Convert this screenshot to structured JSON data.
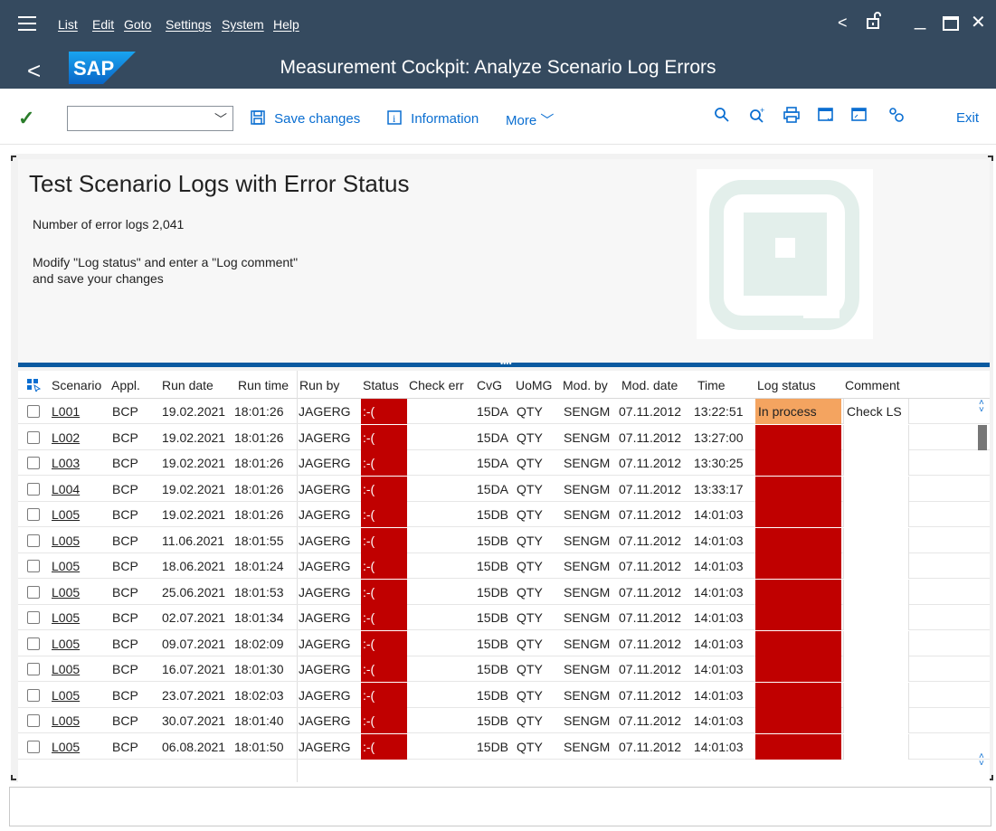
{
  "menu": [
    "List",
    "Edit",
    "Goto",
    "Settings",
    "System",
    "Help"
  ],
  "window_controls": [
    "<",
    "unlock",
    "_",
    "□",
    "×"
  ],
  "app": {
    "logo_text": "SAP",
    "title": "Measurement Cockpit: Analyze Scenario Log Errors"
  },
  "toolbar": {
    "command_value": "",
    "save_label": "Save changes",
    "info_label": "Information",
    "more_label": "More",
    "exit_label": "Exit",
    "icons": [
      "search-icon",
      "search-next-icon",
      "print-icon",
      "layout-icon",
      "window-icon",
      "settings-icon"
    ]
  },
  "header": {
    "title": "Test Scenario Logs with Error Status",
    "count_line": "Number of error logs 2,041",
    "instr1": "Modify \"Log status\" and enter a \"Log comment\"",
    "instr2": "and save your changes"
  },
  "table": {
    "columns": [
      "Scenario",
      "Appl.",
      "Run date",
      "Run time",
      "Run by",
      "Status",
      "Check err",
      "CvG",
      "UoMG",
      "Mod. by",
      "Mod. date",
      "Time",
      "Log status",
      "Comment"
    ],
    "rows": [
      {
        "scenario": "L001",
        "appl": "BCP",
        "run_date": "19.02.2021",
        "run_time": "18:01:26",
        "run_by": "JAGERG",
        "status": ":-(",
        "cvg": "15DA",
        "uomg": "QTY",
        "mod_by": "SENGM",
        "mod_date": "07.11.2012",
        "time": "13:22:51",
        "log_status": "In process",
        "comment": "Check LS"
      },
      {
        "scenario": "L002",
        "appl": "BCP",
        "run_date": "19.02.2021",
        "run_time": "18:01:26",
        "run_by": "JAGERG",
        "status": ":-(",
        "cvg": "15DA",
        "uomg": "QTY",
        "mod_by": "SENGM",
        "mod_date": "07.11.2012",
        "time": "13:27:00",
        "log_status": "",
        "comment": ""
      },
      {
        "scenario": "L003",
        "appl": "BCP",
        "run_date": "19.02.2021",
        "run_time": "18:01:26",
        "run_by": "JAGERG",
        "status": ":-(",
        "cvg": "15DA",
        "uomg": "QTY",
        "mod_by": "SENGM",
        "mod_date": "07.11.2012",
        "time": "13:30:25",
        "log_status": "",
        "comment": ""
      },
      {
        "scenario": "L004",
        "appl": "BCP",
        "run_date": "19.02.2021",
        "run_time": "18:01:26",
        "run_by": "JAGERG",
        "status": ":-(",
        "cvg": "15DA",
        "uomg": "QTY",
        "mod_by": "SENGM",
        "mod_date": "07.11.2012",
        "time": "13:33:17",
        "log_status": "",
        "comment": ""
      },
      {
        "scenario": "L005",
        "appl": "BCP",
        "run_date": "19.02.2021",
        "run_time": "18:01:26",
        "run_by": "JAGERG",
        "status": ":-(",
        "cvg": "15DB",
        "uomg": "QTY",
        "mod_by": "SENGM",
        "mod_date": "07.11.2012",
        "time": "14:01:03",
        "log_status": "",
        "comment": ""
      },
      {
        "scenario": "L005",
        "appl": "BCP",
        "run_date": "11.06.2021",
        "run_time": "18:01:55",
        "run_by": "JAGERG",
        "status": ":-(",
        "cvg": "15DB",
        "uomg": "QTY",
        "mod_by": "SENGM",
        "mod_date": "07.11.2012",
        "time": "14:01:03",
        "log_status": "",
        "comment": ""
      },
      {
        "scenario": "L005",
        "appl": "BCP",
        "run_date": "18.06.2021",
        "run_time": "18:01:24",
        "run_by": "JAGERG",
        "status": ":-(",
        "cvg": "15DB",
        "uomg": "QTY",
        "mod_by": "SENGM",
        "mod_date": "07.11.2012",
        "time": "14:01:03",
        "log_status": "",
        "comment": ""
      },
      {
        "scenario": "L005",
        "appl": "BCP",
        "run_date": "25.06.2021",
        "run_time": "18:01:53",
        "run_by": "JAGERG",
        "status": ":-(",
        "cvg": "15DB",
        "uomg": "QTY",
        "mod_by": "SENGM",
        "mod_date": "07.11.2012",
        "time": "14:01:03",
        "log_status": "",
        "comment": ""
      },
      {
        "scenario": "L005",
        "appl": "BCP",
        "run_date": "02.07.2021",
        "run_time": "18:01:34",
        "run_by": "JAGERG",
        "status": ":-(",
        "cvg": "15DB",
        "uomg": "QTY",
        "mod_by": "SENGM",
        "mod_date": "07.11.2012",
        "time": "14:01:03",
        "log_status": "",
        "comment": ""
      },
      {
        "scenario": "L005",
        "appl": "BCP",
        "run_date": "09.07.2021",
        "run_time": "18:02:09",
        "run_by": "JAGERG",
        "status": ":-(",
        "cvg": "15DB",
        "uomg": "QTY",
        "mod_by": "SENGM",
        "mod_date": "07.11.2012",
        "time": "14:01:03",
        "log_status": "",
        "comment": ""
      },
      {
        "scenario": "L005",
        "appl": "BCP",
        "run_date": "16.07.2021",
        "run_time": "18:01:30",
        "run_by": "JAGERG",
        "status": ":-(",
        "cvg": "15DB",
        "uomg": "QTY",
        "mod_by": "SENGM",
        "mod_date": "07.11.2012",
        "time": "14:01:03",
        "log_status": "",
        "comment": ""
      },
      {
        "scenario": "L005",
        "appl": "BCP",
        "run_date": "23.07.2021",
        "run_time": "18:02:03",
        "run_by": "JAGERG",
        "status": ":-(",
        "cvg": "15DB",
        "uomg": "QTY",
        "mod_by": "SENGM",
        "mod_date": "07.11.2012",
        "time": "14:01:03",
        "log_status": "",
        "comment": ""
      },
      {
        "scenario": "L005",
        "appl": "BCP",
        "run_date": "30.07.2021",
        "run_time": "18:01:40",
        "run_by": "JAGERG",
        "status": ":-(",
        "cvg": "15DB",
        "uomg": "QTY",
        "mod_by": "SENGM",
        "mod_date": "07.11.2012",
        "time": "14:01:03",
        "log_status": "",
        "comment": ""
      },
      {
        "scenario": "L005",
        "appl": "BCP",
        "run_date": "06.08.2021",
        "run_time": "18:01:50",
        "run_by": "JAGERG",
        "status": ":-(",
        "cvg": "15DB",
        "uomg": "QTY",
        "mod_by": "SENGM",
        "mod_date": "07.11.2012",
        "time": "14:01:03",
        "log_status": "",
        "comment": ""
      }
    ]
  },
  "colors": {
    "shell": "#354a5f",
    "error_red": "#c00000",
    "in_process_orange": "#f4a460",
    "link_blue": "#0a6ed1"
  }
}
